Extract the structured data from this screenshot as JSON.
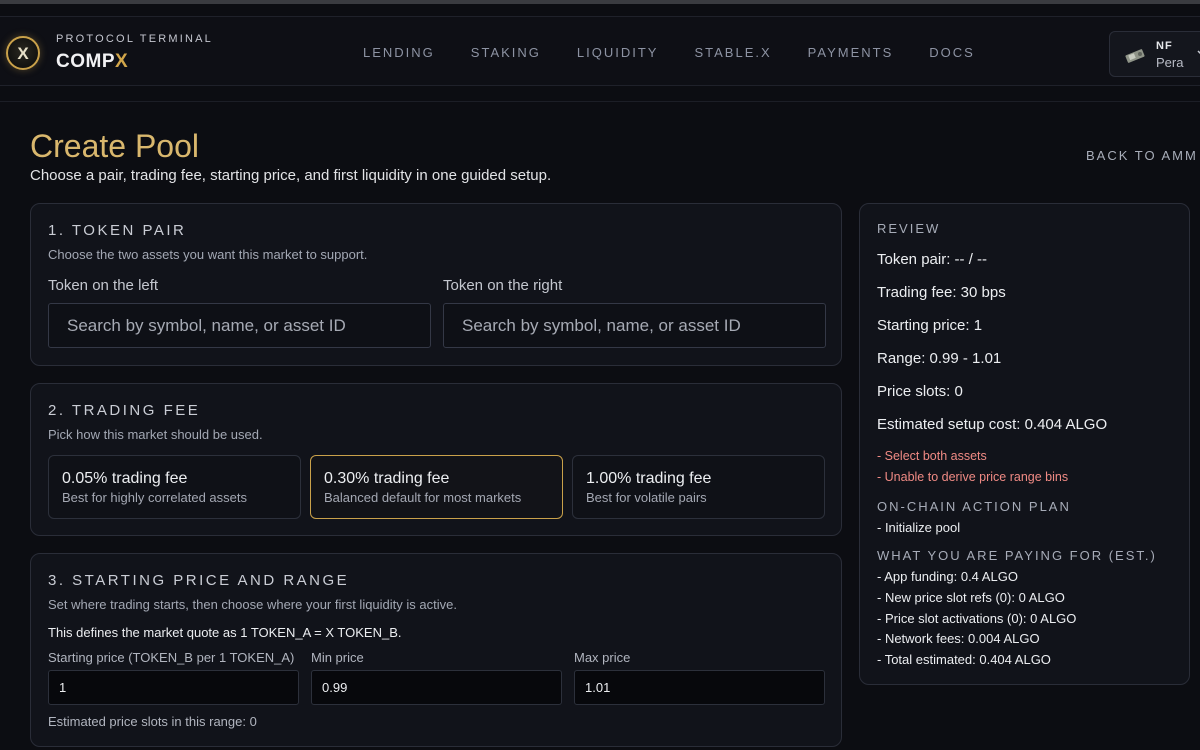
{
  "header": {
    "brand_sub": "PROTOCOL TERMINAL",
    "brand_main": "COMP",
    "brand_accent": "X",
    "logo_letter": "X",
    "nav": [
      "LENDING",
      "STAKING",
      "LIQUIDITY",
      "STABLE.X",
      "PAYMENTS",
      "DOCS"
    ],
    "wallet": {
      "code": "NF",
      "name": "Pera"
    }
  },
  "page": {
    "title": "Create Pool",
    "subtitle": "Choose a pair, trading fee, starting price, and first liquidity in one guided setup.",
    "back_link": "BACK TO AMM"
  },
  "token_pair": {
    "title": "1. TOKEN PAIR",
    "desc": "Choose the two assets you want this market to support.",
    "left_label": "Token on the left",
    "right_label": "Token on the right",
    "left_placeholder": "Search by symbol, name, or asset ID",
    "right_placeholder": "Search by symbol, name, or asset ID"
  },
  "trading_fee": {
    "title": "2. TRADING FEE",
    "desc": "Pick how this market should be used.",
    "options": [
      {
        "label": "0.05% trading fee",
        "desc": "Best for highly correlated assets"
      },
      {
        "label": "0.30% trading fee",
        "desc": "Balanced default for most markets"
      },
      {
        "label": "1.00% trading fee",
        "desc": "Best for volatile pairs"
      }
    ],
    "selected": "0.30% trading fee"
  },
  "price_range": {
    "title": "3. STARTING PRICE AND RANGE",
    "desc": "Set where trading starts, then choose where your first liquidity is active.",
    "note": "This defines the market quote as 1 TOKEN_A = X TOKEN_B.",
    "start_label": "Starting price (TOKEN_B per 1 TOKEN_A)",
    "start_value": "1",
    "min_label": "Min price",
    "min_value": "0.99",
    "max_label": "Max price",
    "max_value": "1.01",
    "slots_note": "Estimated price slots in this range: 0"
  },
  "review": {
    "title": "REVIEW",
    "lines": [
      "Token pair: -- / --",
      "Trading fee: 30 bps",
      "Starting price: 1",
      "Range: 0.99 - 1.01",
      "Price slots: 0",
      "Estimated setup cost: 0.404 ALGO"
    ],
    "warnings": [
      "- Select both assets",
      "- Unable to derive price range bins"
    ],
    "plan_title": "ON-CHAIN ACTION PLAN",
    "plan_items": [
      "- Initialize pool"
    ],
    "paying_title": "WHAT YOU ARE PAYING FOR (EST.)",
    "paying_items": [
      "- App funding: 0.4 ALGO",
      "- New price slot refs (0): 0 ALGO",
      "- Price slot activations (0): 0 ALGO",
      "- Network fees: 0.004 ALGO",
      "- Total estimated: 0.404 ALGO"
    ]
  },
  "colors": {
    "accent": "#d2a64a",
    "background": "#0c0d12",
    "card": "#11131a",
    "warning": "#f08a84"
  }
}
